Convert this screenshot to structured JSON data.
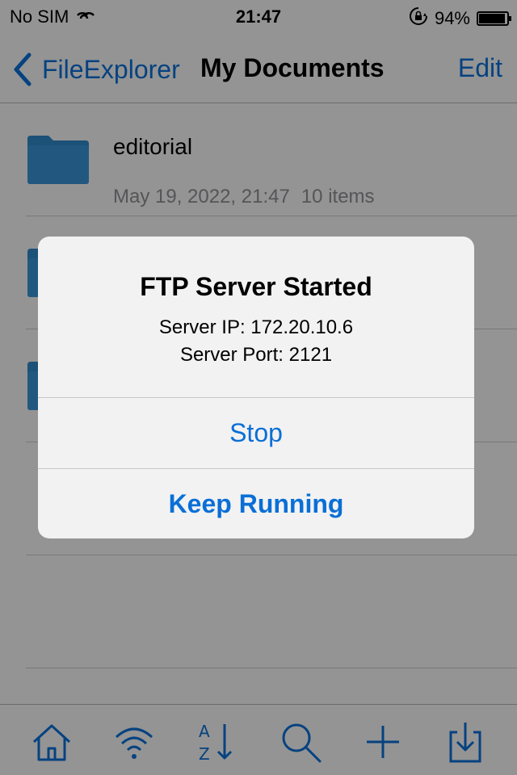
{
  "status_bar": {
    "carrier": "No SIM",
    "time": "21:47",
    "battery": "94%",
    "battery_level": 0.94,
    "icons": [
      "wifi-signal-icon",
      "rotation-lock-icon",
      "battery-icon"
    ]
  },
  "nav": {
    "back_label": "FileExplorer",
    "title": "My Documents",
    "edit_label": "Edit"
  },
  "list": {
    "items": [
      {
        "name": "editorial",
        "date": "May 19, 2022, 21:47",
        "count": "10 items"
      },
      {
        "name": "",
        "date": "",
        "count": ""
      },
      {
        "name": "",
        "date": "",
        "count": ""
      },
      {
        "name": "",
        "date": "",
        "count": ""
      },
      {
        "name": "",
        "date": "",
        "count": ""
      }
    ]
  },
  "toolbar": {
    "icons": [
      "home-icon",
      "wifi-icon",
      "sort-az-icon",
      "search-icon",
      "add-icon",
      "import-icon"
    ]
  },
  "alert": {
    "title": "FTP Server Started",
    "ip_line": "Server IP: 172.20.10.6",
    "port_line": "Server Port: 2121",
    "stop_label": "Stop",
    "keep_label": "Keep Running"
  },
  "colors": {
    "accent": "#0a6fd6",
    "folder": "#2f87c9"
  }
}
